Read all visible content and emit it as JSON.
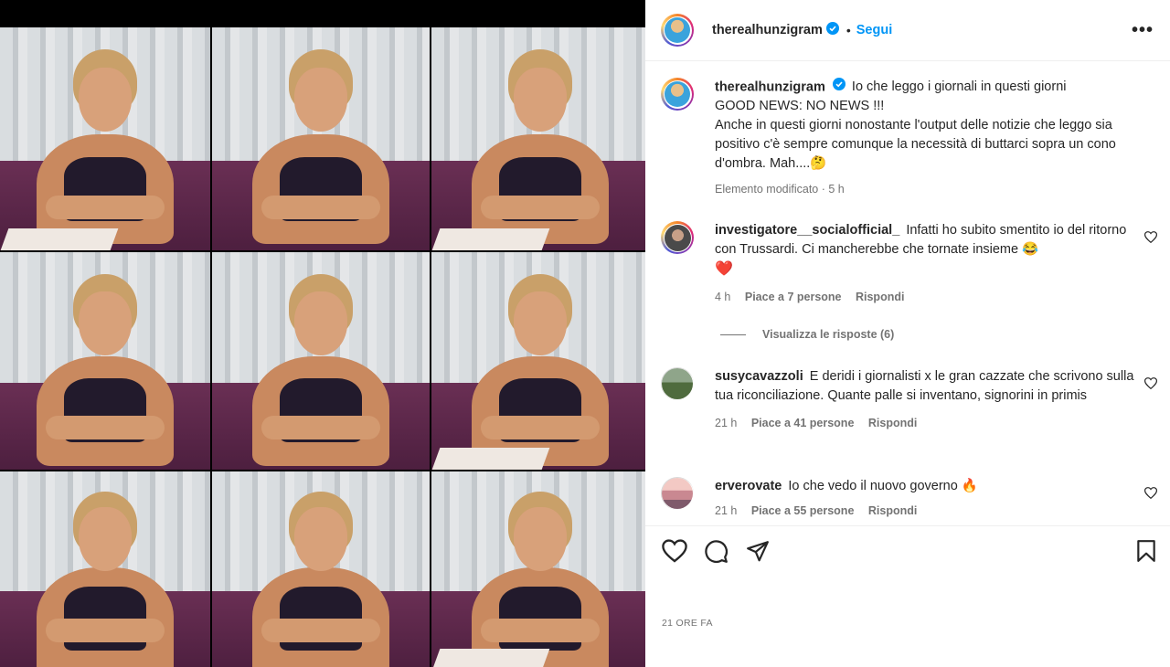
{
  "post": {
    "author": "therealhunzigram",
    "follow_label": "Segui",
    "separator": "•",
    "more_label": "•••",
    "caption_lines": [
      "Io che leggo i giornali in questi giorni",
      "GOOD NEWS: NO NEWS !!!",
      "Anche in questi giorni nonostante l'output delle notizie che leggo sia positivo c'è sempre comunque la necessità di buttarci sopra un cono d'ombra. Mah....🤔"
    ],
    "caption_meta": "Elemento modificato · 5 h",
    "time_ago": "21 ORE FA"
  },
  "comments": [
    {
      "user": "investigatore__socialofficial_",
      "text": "Infatti ho subito smentito io del ritorno con Trussardi. Ci mancherebbe che tornate insieme 😂",
      "emoji_line": "❤️",
      "time": "4 h",
      "likes": "Piace a 7 persone",
      "reply": "Rispondi",
      "view_replies": "Visualizza le risposte (6)"
    },
    {
      "user": "susycavazzoli",
      "text": "E deridi i giornalisti x le gran cazzate che scrivono sulla tua riconciliazione. Quante palle si inventano, signorini in primis",
      "time": "21 h",
      "likes": "Piace a 41 persone",
      "reply": "Rispondi"
    },
    {
      "user": "erverovate",
      "text": "Io che vedo il nuovo governo 🔥",
      "time": "21 h",
      "likes": "Piace a 55 persone",
      "reply": "Rispondi"
    }
  ],
  "icons": {
    "like": "heart-icon",
    "comment": "comment-icon",
    "share": "send-icon",
    "save": "bookmark-icon"
  },
  "colors": {
    "accent": "#0095f6",
    "muted": "#737373",
    "text": "#262626"
  }
}
